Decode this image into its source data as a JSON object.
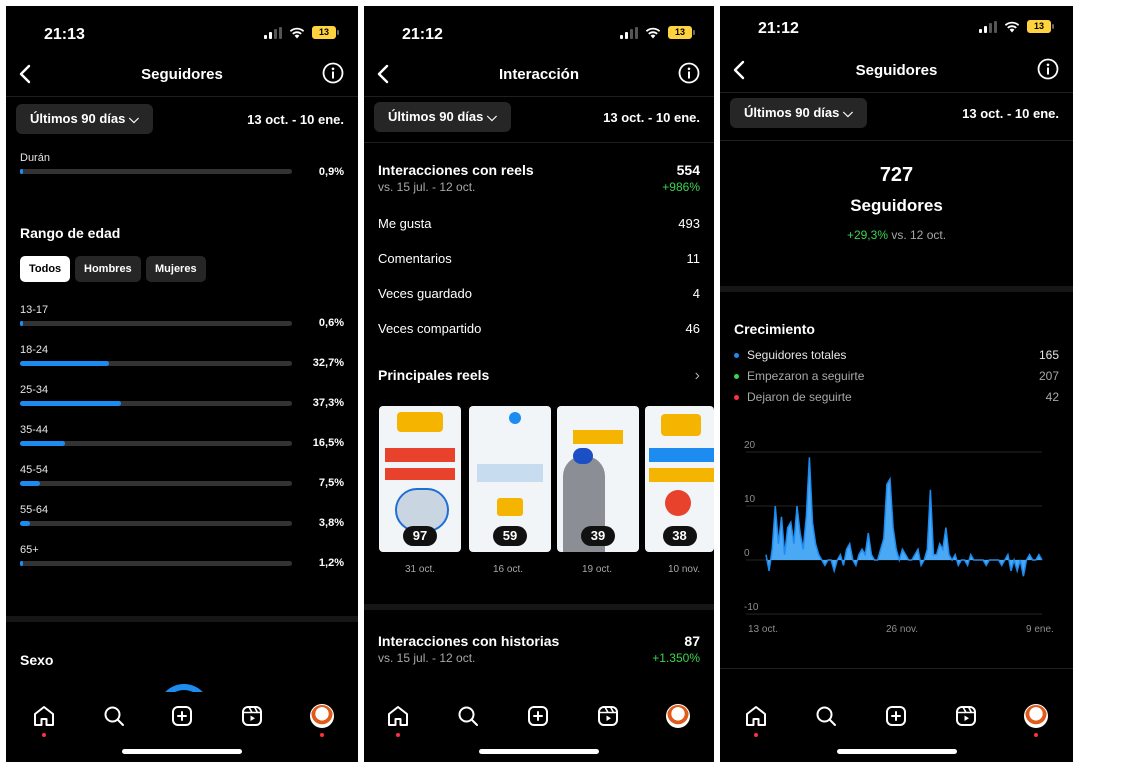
{
  "screens": [
    {
      "time": "21:13",
      "battery": "13",
      "title": "Seguidores",
      "period": "Últimos 90 días",
      "date_range": "13 oct. - 10 ene.",
      "top_city": {
        "label": "Durán",
        "value": "0,9%",
        "fraction": 0.009
      },
      "age_section": "Rango de edad",
      "segments": [
        "Todos",
        "Hombres",
        "Mujeres"
      ],
      "age_ranges": [
        {
          "label": "13-17",
          "value": "0,6%",
          "fraction": 0.006
        },
        {
          "label": "18-24",
          "value": "32,7%",
          "fraction": 0.327
        },
        {
          "label": "25-34",
          "value": "37,3%",
          "fraction": 0.373
        },
        {
          "label": "35-44",
          "value": "16,5%",
          "fraction": 0.165
        },
        {
          "label": "45-54",
          "value": "7,5%",
          "fraction": 0.075
        },
        {
          "label": "55-64",
          "value": "3,8%",
          "fraction": 0.038
        },
        {
          "label": "65+",
          "value": "1,2%",
          "fraction": 0.012
        }
      ],
      "sex_section": "Sexo"
    },
    {
      "time": "21:12",
      "battery": "13",
      "title": "Interacción",
      "period": "Últimos 90 días",
      "date_range": "13 oct. - 10 ene.",
      "reels_title": "Interacciones con reels",
      "reels_total": "554",
      "reels_compare": "vs. 15 jul. - 12 oct.",
      "reels_change": "+986%",
      "metrics": [
        {
          "label": "Me gusta",
          "value": "493"
        },
        {
          "label": "Comentarios",
          "value": "11"
        },
        {
          "label": "Veces guardado",
          "value": "4"
        },
        {
          "label": "Veces compartido",
          "value": "46"
        }
      ],
      "top_reels_title": "Principales reels",
      "reels": [
        {
          "count": "97",
          "date": "31 oct."
        },
        {
          "count": "59",
          "date": "16 oct."
        },
        {
          "count": "39",
          "date": "19 oct."
        },
        {
          "count": "38",
          "date": "10 nov."
        }
      ],
      "stories_title": "Interacciones con historias",
      "stories_total": "87",
      "stories_compare": "vs. 15 jul. - 12 oct.",
      "stories_change": "+1.350%"
    },
    {
      "time": "21:12",
      "battery": "13",
      "title": "Seguidores",
      "period": "Últimos 90 días",
      "date_range": "13 oct. - 10 ene.",
      "followers": "727",
      "followers_label": "Seguidores",
      "followers_change": "+29,3%",
      "followers_compare": "vs. 12 oct.",
      "growth_title": "Crecimiento",
      "legend": [
        {
          "label": "Seguidores totales",
          "value": "165",
          "color": "#1d8cf0"
        },
        {
          "label": "Empezaron a seguirte",
          "value": "207",
          "color": "#3bd44f"
        },
        {
          "label": "Dejaron de seguirte",
          "value": "42",
          "color": "#ff3040"
        }
      ]
    }
  ],
  "icons": [
    "back-icon",
    "info-icon",
    "chevron-down-icon",
    "chevron-right-icon",
    "home-icon",
    "search-icon",
    "add-icon",
    "reels-icon",
    "profile-avatar"
  ],
  "chart_data": {
    "type": "area",
    "xticks": [
      "13 oct.",
      "26 nov.",
      "9 ene."
    ],
    "yticks": [
      "20",
      "10",
      "0",
      "-10"
    ],
    "ylim": [
      -10,
      20
    ],
    "grid": true,
    "series": [
      {
        "name": "Seguidores totales",
        "values": [
          1,
          -2,
          2,
          10,
          3,
          8,
          1,
          6,
          7,
          3,
          10,
          5,
          2,
          8,
          19,
          7,
          3,
          1,
          0,
          -1,
          0,
          0,
          -2,
          0,
          1,
          -1,
          2,
          3,
          0,
          -1,
          1,
          2,
          1,
          5,
          1,
          0,
          0,
          2,
          4,
          14,
          15,
          6,
          2,
          0,
          2,
          1,
          0,
          0,
          1,
          2,
          -1,
          0,
          2,
          13,
          1,
          1,
          3,
          2,
          6,
          1,
          0,
          1,
          -1,
          0,
          0,
          -1,
          1,
          0,
          0,
          0,
          0,
          -1,
          0,
          0,
          0,
          0,
          -1,
          0,
          1,
          -2,
          0,
          -2,
          0,
          -3,
          0,
          1,
          0,
          0,
          1,
          0
        ]
      }
    ]
  }
}
